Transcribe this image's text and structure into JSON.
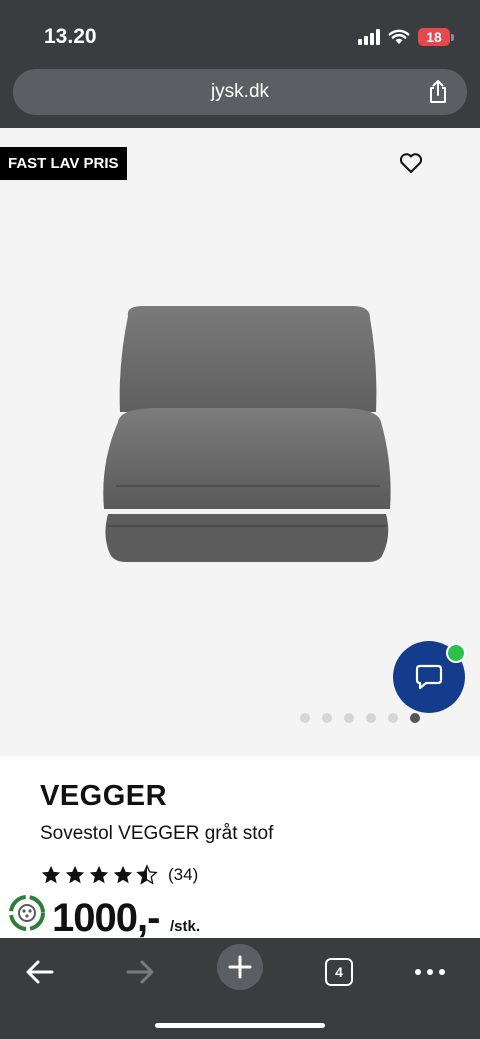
{
  "status": {
    "time": "13.20",
    "battery": "18",
    "icons": [
      "signal-icon",
      "wifi-icon",
      "battery-icon"
    ]
  },
  "browser": {
    "url": "jysk.dk",
    "tab_count": "4",
    "icons": [
      "share-icon",
      "back-arrow-icon",
      "forward-arrow-icon",
      "plus-icon",
      "tabs-icon",
      "more-icon"
    ]
  },
  "gallery": {
    "badge": "FAST LAV PRIS",
    "image_count": 6,
    "active_image_index": 6
  },
  "product": {
    "brand": "VEGGER",
    "title": "Sovestol VEGGER gråt stof",
    "rating": 4.5,
    "review_count": "(34)",
    "price": "1000,-",
    "unit": "/stk."
  },
  "colors": {
    "badge_bg": "#000000",
    "chat_button": "#143c8c",
    "online_dot": "#2bc24b",
    "browser_chrome": "#3a3d40"
  }
}
